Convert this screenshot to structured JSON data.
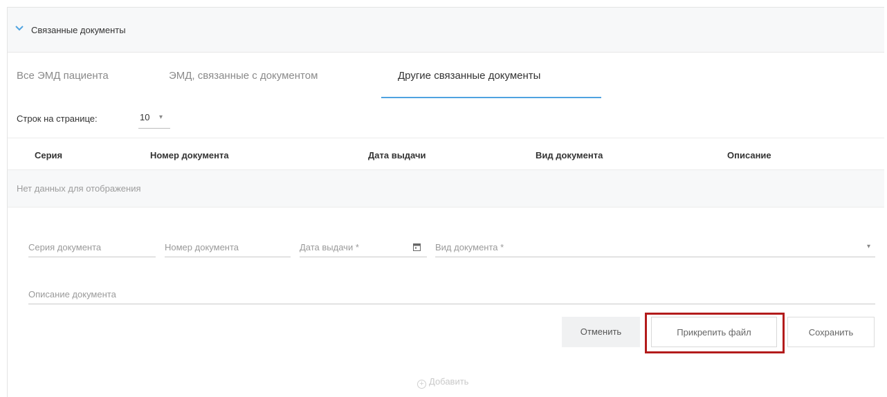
{
  "section": {
    "title": "Связанные документы"
  },
  "tabs": [
    {
      "label": "Все ЭМД пациента",
      "active": false
    },
    {
      "label": "ЭМД, связанные с документом",
      "active": false
    },
    {
      "label": "Другие связанные документы",
      "active": true
    }
  ],
  "pagination": {
    "label": "Строк на странице:",
    "value": "10"
  },
  "table": {
    "columns": [
      "Серия",
      "Номер документа",
      "Дата выдачи",
      "Вид документа",
      "Описание"
    ],
    "empty_text": "Нет данных для отображения"
  },
  "form": {
    "series_placeholder": "Серия документа",
    "number_placeholder": "Номер документа",
    "date_placeholder": "Дата выдачи *",
    "type_placeholder": "Вид документа *",
    "description_placeholder": "Описание документа"
  },
  "buttons": {
    "cancel": "Отменить",
    "attach": "Прикрепить файл",
    "save": "Сохранить",
    "add": "Добавить"
  },
  "colors": {
    "accent": "#4fa3e0",
    "highlight": "#b31b1b"
  },
  "icons": {
    "section_toggle": "chevron-down-icon",
    "date": "calendar-icon",
    "type_dropdown": "caret-down-icon",
    "add": "plus-circle-icon"
  }
}
